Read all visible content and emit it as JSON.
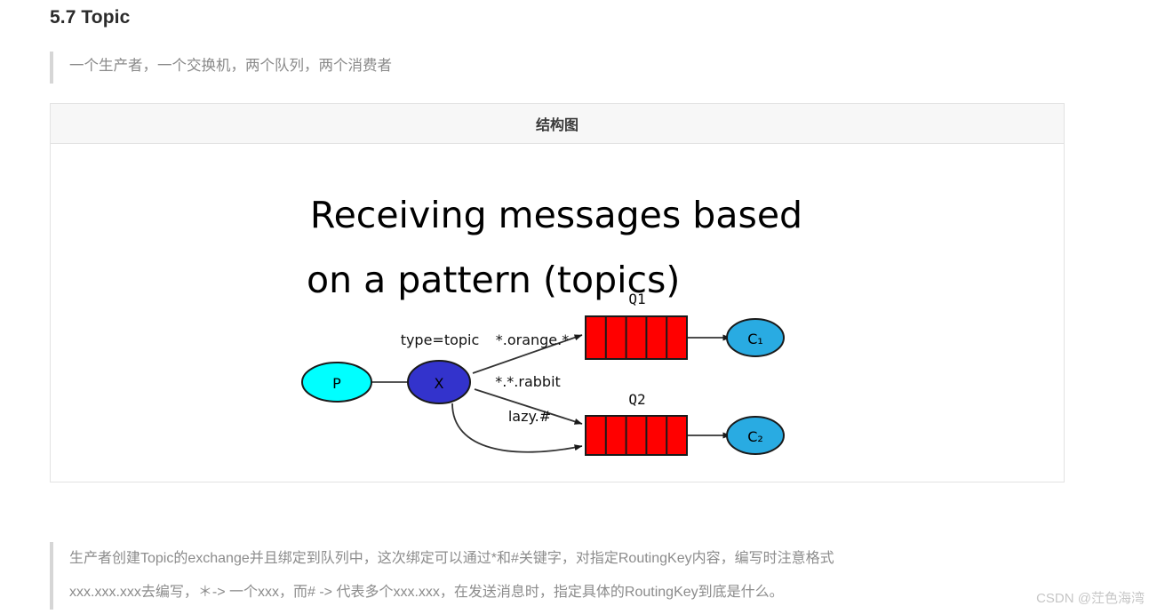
{
  "heading": "5.7 Topic",
  "quote_top": "一个生产者，一个交换机，两个队列，两个消费者",
  "table": {
    "header": "结构图"
  },
  "figure": {
    "title_line1": "Receiving messages based",
    "title_line2": "on a pattern (topics)",
    "producer": "P",
    "exchange": "X",
    "exchange_type_label": "type=topic",
    "bindings": [
      "*.orange.*",
      "*.*.rabbit",
      "lazy.#"
    ],
    "queues": [
      {
        "label": "Q1",
        "cells": 5
      },
      {
        "label": "Q2",
        "cells": 5
      }
    ],
    "consumers": [
      "C₁",
      "C₂"
    ],
    "colors": {
      "producer_fill": "#00ffff",
      "exchange_fill": "#3333cc",
      "queue_fill": "#ff0000",
      "consumer_fill": "#29abe2",
      "stroke": "#1a1a1a"
    }
  },
  "quote_bottom": {
    "line1": "生产者创建Topic的exchange并且绑定到队列中，这次绑定可以通过*和#关键字，对指定RoutingKey内容，编写时注意格式",
    "line2": "xxx.xxx.xxx去编写，＊-> 一个xxx，而# -> 代表多个xxx.xxx，在发送消息时，指定具体的RoutingKey到底是什么。"
  },
  "watermark": "CSDN @茳色海湾"
}
